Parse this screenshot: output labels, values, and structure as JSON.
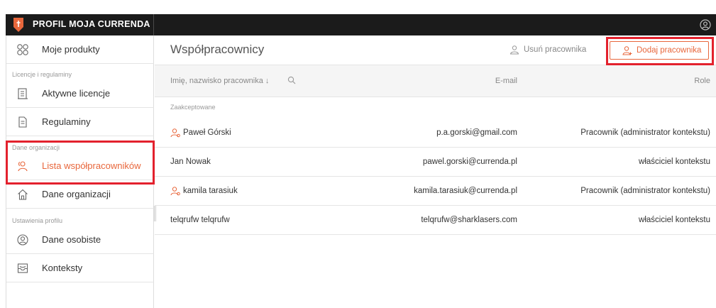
{
  "app": {
    "title": "PROFIL MOJA CURRENDA",
    "logo_color": "#e8673c"
  },
  "sidebar": {
    "top_item": {
      "label": "Moje produkty",
      "icon": "grid-icon"
    },
    "sections": [
      {
        "label": "Licencje i regulaminy"
      },
      {
        "label": "Dane organizacji"
      },
      {
        "label": "Ustawienia profilu"
      }
    ],
    "items": [
      {
        "label": "Aktywne licencje",
        "icon": "license-icon"
      },
      {
        "label": "Regulaminy",
        "icon": "document-icon"
      },
      {
        "label": "Lista współpracowników",
        "icon": "users-icon",
        "active": true
      },
      {
        "label": "Dane organizacji",
        "icon": "home-icon"
      },
      {
        "label": "Dane osobiste",
        "icon": "user-circle-icon"
      },
      {
        "label": "Konteksty",
        "icon": "inbox-icon"
      }
    ]
  },
  "main": {
    "title": "Współpracownicy",
    "remove_button": "Usuń pracownika",
    "add_button": "Dodaj pracownika",
    "table": {
      "columns": [
        "Imię, nazwisko pracownika ↓",
        "E-mail",
        "Role"
      ],
      "group_label": "Zaakceptowane",
      "rows": [
        {
          "name": "Paweł Górski",
          "email": "p.a.gorski@gmail.com",
          "role": "Pracownik (administrator kontekstu)",
          "admin_icon": true
        },
        {
          "name": "Jan Nowak",
          "email": "pawel.gorski@currenda.pl",
          "role": "właściciel kontekstu",
          "admin_icon": false
        },
        {
          "name": "kamila tarasiuk",
          "email": "kamila.tarasiuk@currenda.pl",
          "role": "Pracownik (administrator kontekstu)",
          "admin_icon": true
        },
        {
          "name": "telqrufw telqrufw",
          "email": "telqrufw@sharklasers.com",
          "role": "właściciel kontekstu",
          "admin_icon": false
        }
      ]
    }
  },
  "colors": {
    "accent": "#e8673c",
    "highlight": "#e3212d",
    "topbar": "#1b1b1b"
  }
}
